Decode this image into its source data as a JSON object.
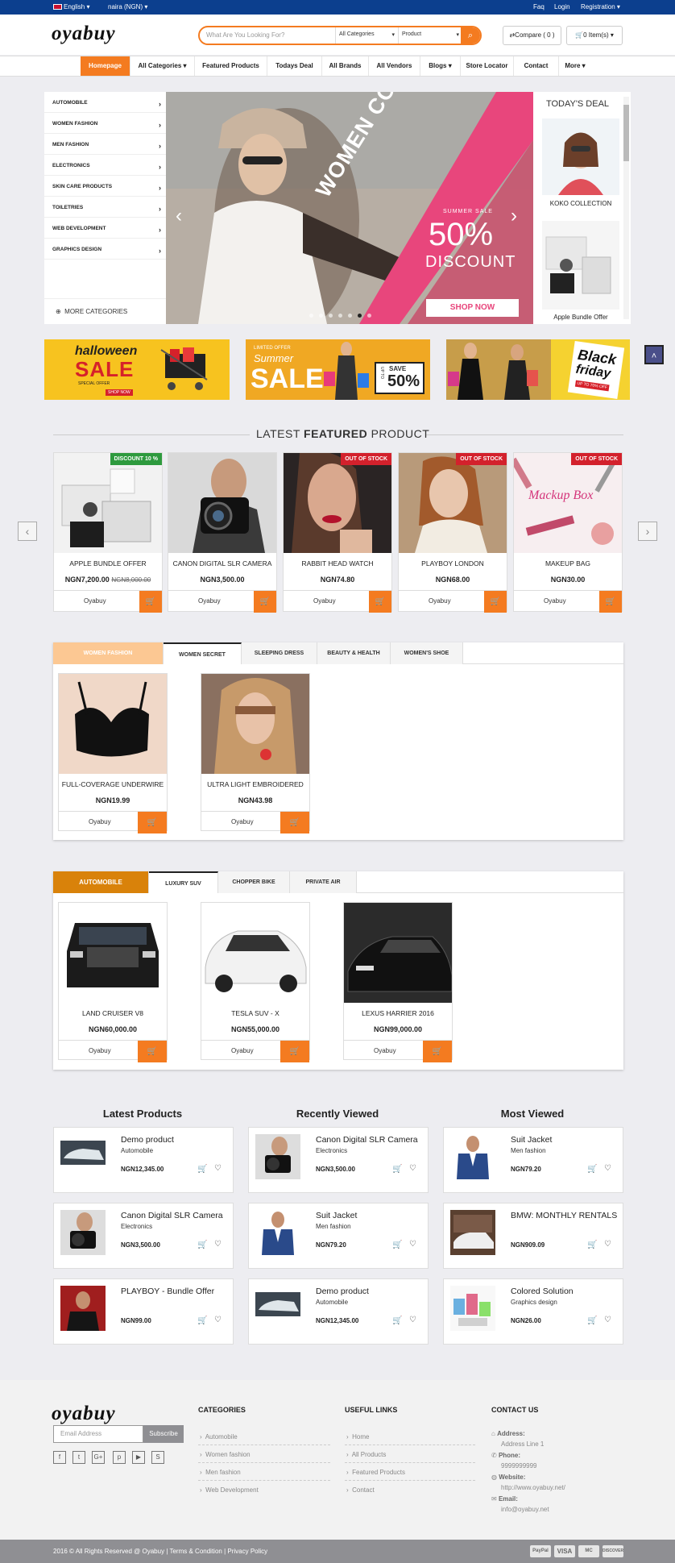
{
  "topbar": {
    "language": "English",
    "currency": "naira (NGN)",
    "links": [
      "Faq",
      "Login",
      "Registration"
    ]
  },
  "header": {
    "logo": "oyabuy",
    "search_placeholder": "What Are You Looking For?",
    "category_select": "All Categories",
    "type_select": "Product",
    "compare": "Compare ( 0 )",
    "cart": "0 Item(s)"
  },
  "nav": [
    "Homepage",
    "All Categories",
    "Featured Products",
    "Todays Deal",
    "All Brands",
    "All Vendors",
    "Blogs",
    "Store Locator",
    "Contact",
    "More"
  ],
  "categories": [
    "AUTOMOBILE",
    "WOMEN FASHION",
    "MEN FASHION",
    "ELECTRONICS",
    "SKIN CARE PRODUCTS",
    "TOILETRIES",
    "WEB DEVELOPMENT",
    "GRAPHICS DESIGN"
  ],
  "more_categories": "MORE CATEGORIES",
  "slider": {
    "ribbon": "WOMEN COLLECTION",
    "tag": "SUMMER SALE",
    "pct": "50%",
    "discount": "DISCOUNT",
    "cta": "SHOP NOW"
  },
  "deal": {
    "title": "TODAY'S DEAL",
    "items": [
      "KOKO COLLECTION",
      "Apple Bundle Offer"
    ]
  },
  "banners": [
    {
      "line1": "halloween",
      "line2": "SALE",
      "line3": "SPECIAL OFFER",
      "cta": "SHOP NOW"
    },
    {
      "line1": "LIMITED OFFER",
      "line2": "Summer",
      "line3": "SALE",
      "save": "SAVE",
      "upto": "UP TO",
      "pct": "50%"
    },
    {
      "line1": "Black",
      "line2": "friday",
      "line3": "UP TO 70% OFF"
    }
  ],
  "featured": {
    "title_a": "LATEST",
    "title_b": "FEATURED",
    "title_c": "PRODUCT",
    "products": [
      {
        "name": "APPLE BUNDLE OFFER",
        "price": "NGN7,200.00",
        "old": "NGN8,000.00",
        "badge": "DISCOUNT 10 %",
        "seller": "Oyabuy"
      },
      {
        "name": "CANON DIGITAL SLR CAMERA",
        "price": "NGN3,500.00",
        "old": "",
        "badge": "",
        "seller": "Oyabuy"
      },
      {
        "name": "RABBIT HEAD WATCH",
        "price": "NGN74.80",
        "old": "",
        "badge": "OUT OF STOCK",
        "seller": "Oyabuy"
      },
      {
        "name": "PLAYBOY LONDON",
        "price": "NGN68.00",
        "old": "",
        "badge": "OUT OF STOCK",
        "seller": "Oyabuy"
      },
      {
        "name": "MAKEUP BAG",
        "price": "NGN30.00",
        "old": "",
        "badge": "OUT OF STOCK",
        "seller": "Oyabuy",
        "img_text": "Mackup Box"
      }
    ]
  },
  "fashion": {
    "tabs": [
      "WOMEN FASHION",
      "WOMEN SECRET",
      "SLEEPING DRESS",
      "BEAUTY & HEALTH",
      "WOMEN'S SHOE"
    ],
    "products": [
      {
        "name": "FULL-COVERAGE UNDERWIRE",
        "price": "NGN19.99",
        "seller": "Oyabuy"
      },
      {
        "name": "ULTRA LIGHT EMBROIDERED",
        "price": "NGN43.98",
        "seller": "Oyabuy"
      }
    ]
  },
  "auto": {
    "tabs": [
      "AUTOMOBILE",
      "LUXURY SUV",
      "CHOPPER BIKE",
      "PRIVATE AIR"
    ],
    "products": [
      {
        "name": "LAND CRUISER V8",
        "price": "NGN60,000.00",
        "seller": "Oyabuy"
      },
      {
        "name": "TESLA SUV - X",
        "price": "NGN55,000.00",
        "seller": "Oyabuy"
      },
      {
        "name": "LEXUS HARRIER 2016",
        "price": "NGN99,000.00",
        "seller": "Oyabuy"
      }
    ]
  },
  "lists": {
    "latest": {
      "title": "Latest Products",
      "items": [
        {
          "name": "Demo product",
          "cat": "Automobile",
          "price": "NGN12,345.00"
        },
        {
          "name": "Canon Digital SLR Camera",
          "cat": "Electronics",
          "price": "NGN3,500.00"
        },
        {
          "name": "PLAYBOY - Bundle Offer",
          "cat": "",
          "price": "NGN99.00"
        }
      ]
    },
    "recent": {
      "title": "Recently Viewed",
      "items": [
        {
          "name": "Canon Digital SLR Camera",
          "cat": "Electronics",
          "price": "NGN3,500.00"
        },
        {
          "name": "Suit Jacket",
          "cat": "Men fashion",
          "price": "NGN79.20"
        },
        {
          "name": "Demo product",
          "cat": "Automobile",
          "price": "NGN12,345.00"
        }
      ]
    },
    "most": {
      "title": "Most Viewed",
      "items": [
        {
          "name": "Suit Jacket",
          "cat": "Men fashion",
          "price": "NGN79.20"
        },
        {
          "name": "BMW: MONTHLY RENTALS",
          "cat": "",
          "price": "NGN909.09"
        },
        {
          "name": "Colored Solution",
          "cat": "Graphics design",
          "price": "NGN26.00"
        }
      ]
    }
  },
  "footer": {
    "email_placeholder": "Email Address",
    "subscribe": "Subscribe",
    "categories_title": "CATEGORIES",
    "categories": [
      "Automobile",
      "Women fashion",
      "Men fashion",
      "Web Development"
    ],
    "links_title": "USEFUL LINKS",
    "links": [
      "Home",
      "All Products",
      "Featured Products",
      "Contact"
    ],
    "contact_title": "CONTACT US",
    "address_label": "Address:",
    "address": "Address Line 1",
    "phone_label": "Phone:",
    "phone": "9999999999",
    "website_label": "Website:",
    "website": "http://www.oyabuy.net/",
    "email_label": "Email:",
    "email": "info@oyabuy.net",
    "copyright": "2016 © All Rights Reserved @ Oyabuy",
    "terms": "Terms & Condition",
    "privacy": "Privacy Policy",
    "payments": [
      "PayPal",
      "VISA",
      "MC",
      "DISCOVER"
    ]
  },
  "colors": {
    "accent": "#f47b20",
    "topbar": "#0c3f8e",
    "badge_red": "#d3212c",
    "badge_green": "#2e9a3e"
  }
}
